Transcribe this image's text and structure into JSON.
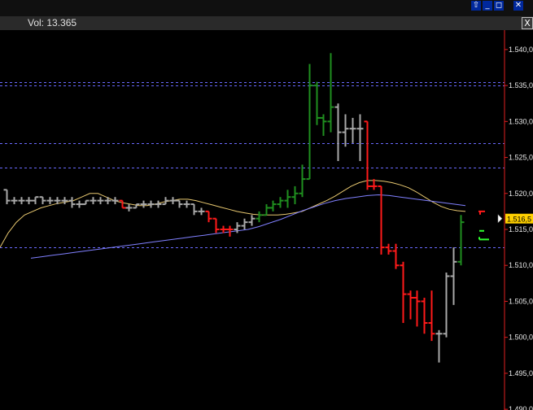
{
  "window": {
    "buttons": [
      {
        "name": "menu-arrow",
        "glyph": "⇧"
      },
      {
        "name": "minimize",
        "glyph": "_"
      },
      {
        "name": "restore",
        "glyph": "◻"
      },
      {
        "name": "close",
        "glyph": "✕"
      }
    ]
  },
  "volume": {
    "label": "Vol:",
    "value": "13.365"
  },
  "panel_close": "X",
  "colors": {
    "background": "#000000",
    "up_bar": "#1f8f1f",
    "down_bar": "#ff1a1a",
    "neutral_bar": "#a8a8a8",
    "ma_fast": "#e8c870",
    "ma_slow": "#8080ff",
    "grid": "#6a6aff",
    "axis_line": "#e02020",
    "price_tag_bg": "#ffd000"
  },
  "chart_data": {
    "type": "ohlc",
    "y_axis_side": "right",
    "grid": "horizontal-dashed",
    "y_ticks": [
      "1.540,0",
      "1.535,0",
      "1.530,0",
      "1.525,0",
      "1.520,0",
      "1.515,0",
      "1.510,0",
      "1.505,0",
      "1.500,0",
      "1.495,0",
      "1.490,0"
    ],
    "y_values": [
      1540,
      1535,
      1530,
      1525,
      1520,
      1515,
      1510,
      1505,
      1500,
      1495,
      1490
    ],
    "ylim": [
      1489.9,
      1542.7
    ],
    "current_price_label": "1.516,5",
    "current_price": 1516.5,
    "grid_levels": [
      1535.5,
      1535.0,
      1527.0,
      1523.6,
      1512.5
    ],
    "bars": [
      {
        "o": 1520.5,
        "h": 1520.5,
        "l": 1518.5,
        "c": 1519.0,
        "d": "n"
      },
      {
        "o": 1519.0,
        "h": 1519.5,
        "l": 1518.5,
        "c": 1519.0,
        "d": "n"
      },
      {
        "o": 1519.0,
        "h": 1519.5,
        "l": 1518.5,
        "c": 1519.0,
        "d": "n"
      },
      {
        "o": 1519.0,
        "h": 1519.5,
        "l": 1518.5,
        "c": 1519.0,
        "d": "n"
      },
      {
        "o": 1519.0,
        "h": 1519.5,
        "l": 1518.5,
        "c": 1519.5,
        "d": "n"
      },
      {
        "o": 1519.5,
        "h": 1519.5,
        "l": 1518.5,
        "c": 1519.0,
        "d": "n"
      },
      {
        "o": 1519.0,
        "h": 1519.5,
        "l": 1518.5,
        "c": 1519.0,
        "d": "n"
      },
      {
        "o": 1519.0,
        "h": 1519.5,
        "l": 1518.5,
        "c": 1519.0,
        "d": "n"
      },
      {
        "o": 1519.0,
        "h": 1519.5,
        "l": 1518.5,
        "c": 1519.0,
        "d": "n"
      },
      {
        "o": 1519.0,
        "h": 1519.5,
        "l": 1518.0,
        "c": 1518.5,
        "d": "n"
      },
      {
        "o": 1518.5,
        "h": 1519.0,
        "l": 1518.0,
        "c": 1518.5,
        "d": "n"
      },
      {
        "o": 1518.5,
        "h": 1519.0,
        "l": 1518.5,
        "c": 1519.0,
        "d": "n"
      },
      {
        "o": 1519.0,
        "h": 1519.5,
        "l": 1518.5,
        "c": 1519.0,
        "d": "n"
      },
      {
        "o": 1519.0,
        "h": 1519.5,
        "l": 1518.5,
        "c": 1519.0,
        "d": "n"
      },
      {
        "o": 1519.0,
        "h": 1519.5,
        "l": 1518.5,
        "c": 1519.0,
        "d": "n"
      },
      {
        "o": 1519.0,
        "h": 1519.5,
        "l": 1518.5,
        "c": 1519.0,
        "d": "n"
      },
      {
        "o": 1519.0,
        "h": 1519.0,
        "l": 1518.0,
        "c": 1518.0,
        "d": "d"
      },
      {
        "o": 1518.0,
        "h": 1518.5,
        "l": 1517.5,
        "c": 1518.0,
        "d": "n"
      },
      {
        "o": 1518.0,
        "h": 1518.5,
        "l": 1518.0,
        "c": 1518.5,
        "d": "n"
      },
      {
        "o": 1518.5,
        "h": 1519.0,
        "l": 1518.0,
        "c": 1518.5,
        "d": "n"
      },
      {
        "o": 1518.5,
        "h": 1519.0,
        "l": 1518.0,
        "c": 1518.5,
        "d": "n"
      },
      {
        "o": 1518.5,
        "h": 1519.0,
        "l": 1518.0,
        "c": 1518.5,
        "d": "n"
      },
      {
        "o": 1518.5,
        "h": 1519.5,
        "l": 1518.5,
        "c": 1519.0,
        "d": "n"
      },
      {
        "o": 1519.0,
        "h": 1519.5,
        "l": 1518.5,
        "c": 1519.0,
        "d": "n"
      },
      {
        "o": 1519.0,
        "h": 1519.0,
        "l": 1518.0,
        "c": 1518.5,
        "d": "n"
      },
      {
        "o": 1518.5,
        "h": 1519.0,
        "l": 1518.0,
        "c": 1518.5,
        "d": "n"
      },
      {
        "o": 1518.5,
        "h": 1518.5,
        "l": 1517.0,
        "c": 1517.5,
        "d": "n"
      },
      {
        "o": 1517.5,
        "h": 1518.0,
        "l": 1517.0,
        "c": 1517.5,
        "d": "n"
      },
      {
        "o": 1517.5,
        "h": 1517.5,
        "l": 1516.0,
        "c": 1516.5,
        "d": "d"
      },
      {
        "o": 1516.5,
        "h": 1516.5,
        "l": 1514.5,
        "c": 1515.0,
        "d": "d"
      },
      {
        "o": 1515.0,
        "h": 1515.5,
        "l": 1514.5,
        "c": 1515.0,
        "d": "d"
      },
      {
        "o": 1515.0,
        "h": 1515.5,
        "l": 1514.0,
        "c": 1515.0,
        "d": "d"
      },
      {
        "o": 1515.0,
        "h": 1516.0,
        "l": 1514.5,
        "c": 1515.5,
        "d": "n"
      },
      {
        "o": 1515.5,
        "h": 1516.5,
        "l": 1515.0,
        "c": 1516.0,
        "d": "n"
      },
      {
        "o": 1516.0,
        "h": 1517.0,
        "l": 1515.5,
        "c": 1516.5,
        "d": "n"
      },
      {
        "o": 1516.5,
        "h": 1517.5,
        "l": 1516.0,
        "c": 1517.0,
        "d": "u"
      },
      {
        "o": 1517.0,
        "h": 1518.5,
        "l": 1517.0,
        "c": 1518.0,
        "d": "u"
      },
      {
        "o": 1518.0,
        "h": 1519.0,
        "l": 1517.5,
        "c": 1518.5,
        "d": "u"
      },
      {
        "o": 1518.5,
        "h": 1519.5,
        "l": 1518.0,
        "c": 1519.0,
        "d": "u"
      },
      {
        "o": 1519.0,
        "h": 1520.5,
        "l": 1518.0,
        "c": 1519.5,
        "d": "u"
      },
      {
        "o": 1519.5,
        "h": 1521.0,
        "l": 1518.5,
        "c": 1520.0,
        "d": "u"
      },
      {
        "o": 1520.0,
        "h": 1524.0,
        "l": 1519.5,
        "c": 1522.0,
        "d": "u"
      },
      {
        "o": 1522.0,
        "h": 1538.0,
        "l": 1522.0,
        "c": 1535.0,
        "d": "u"
      },
      {
        "o": 1535.0,
        "h": 1535.5,
        "l": 1529.5,
        "c": 1530.5,
        "d": "u"
      },
      {
        "o": 1530.5,
        "h": 1531.0,
        "l": 1528.0,
        "c": 1530.0,
        "d": "u"
      },
      {
        "o": 1530.0,
        "h": 1539.5,
        "l": 1528.5,
        "c": 1532.0,
        "d": "u"
      },
      {
        "o": 1532.0,
        "h": 1532.5,
        "l": 1524.5,
        "c": 1528.5,
        "d": "n"
      },
      {
        "o": 1528.5,
        "h": 1531.0,
        "l": 1526.5,
        "c": 1529.0,
        "d": "n"
      },
      {
        "o": 1529.0,
        "h": 1530.5,
        "l": 1527.0,
        "c": 1529.0,
        "d": "n"
      },
      {
        "o": 1529.0,
        "h": 1531.0,
        "l": 1524.5,
        "c": 1529.0,
        "d": "n"
      },
      {
        "o": 1530.0,
        "h": 1530.0,
        "l": 1520.5,
        "c": 1521.0,
        "d": "d"
      },
      {
        "o": 1521.0,
        "h": 1522.0,
        "l": 1520.5,
        "c": 1521.0,
        "d": "d"
      },
      {
        "o": 1521.0,
        "h": 1521.0,
        "l": 1511.5,
        "c": 1512.5,
        "d": "d"
      },
      {
        "o": 1512.5,
        "h": 1513.0,
        "l": 1511.5,
        "c": 1512.0,
        "d": "d"
      },
      {
        "o": 1512.0,
        "h": 1513.0,
        "l": 1509.5,
        "c": 1510.0,
        "d": "d"
      },
      {
        "o": 1510.0,
        "h": 1510.5,
        "l": 1502.0,
        "c": 1506.0,
        "d": "d"
      },
      {
        "o": 1506.0,
        "h": 1506.5,
        "l": 1502.5,
        "c": 1505.5,
        "d": "d"
      },
      {
        "o": 1505.5,
        "h": 1506.5,
        "l": 1501.5,
        "c": 1505.0,
        "d": "d"
      },
      {
        "o": 1505.0,
        "h": 1505.5,
        "l": 1500.5,
        "c": 1502.0,
        "d": "d"
      },
      {
        "o": 1502.0,
        "h": 1506.5,
        "l": 1499.5,
        "c": 1500.5,
        "d": "d"
      },
      {
        "o": 1500.5,
        "h": 1501.0,
        "l": 1496.5,
        "c": 1500.5,
        "d": "n"
      },
      {
        "o": 1500.5,
        "h": 1509.0,
        "l": 1500.0,
        "c": 1508.5,
        "d": "n"
      },
      {
        "o": 1508.5,
        "h": 1512.5,
        "l": 1504.5,
        "c": 1510.5,
        "d": "n"
      },
      {
        "o": 1510.5,
        "h": 1517.0,
        "l": 1510.0,
        "c": 1516.0,
        "d": "u"
      }
    ],
    "ma_fast": [
      1512.5,
      1514.5,
      1516.0,
      1517.0,
      1517.5,
      1518.0,
      1518.3,
      1518.6,
      1518.8,
      1519.0,
      1519.5,
      1520.0,
      1520.0,
      1519.5,
      1519.0,
      1518.7,
      1518.5,
      1518.3,
      1518.3,
      1518.5,
      1518.8,
      1519.0,
      1519.2,
      1519.2,
      1519.0,
      1518.7,
      1518.4,
      1518.1,
      1517.8,
      1517.5,
      1517.3,
      1517.1,
      1517.0,
      1517.0,
      1517.0,
      1517.1,
      1517.3,
      1517.5,
      1518.0,
      1518.5,
      1519.0,
      1519.6,
      1520.3,
      1521.0,
      1521.5,
      1521.8,
      1521.8,
      1521.7,
      1521.5,
      1521.2,
      1520.8,
      1520.2,
      1519.5,
      1518.8,
      1518.2,
      1517.8,
      1517.6,
      1517.5
    ],
    "ma_slow": [
      1511.0,
      1511.2,
      1511.4,
      1511.6,
      1511.8,
      1512.0,
      1512.2,
      1512.4,
      1512.6,
      1512.8,
      1513.0,
      1513.2,
      1513.4,
      1513.6,
      1513.8,
      1514.0,
      1514.2,
      1514.4,
      1514.6,
      1514.8,
      1515.0,
      1515.4,
      1515.9,
      1516.4,
      1517.0,
      1517.6,
      1518.1,
      1518.6,
      1519.0,
      1519.3,
      1519.5,
      1519.7,
      1519.8,
      1519.7,
      1519.5,
      1519.3,
      1519.1,
      1518.9,
      1518.7,
      1518.5,
      1518.3
    ]
  }
}
